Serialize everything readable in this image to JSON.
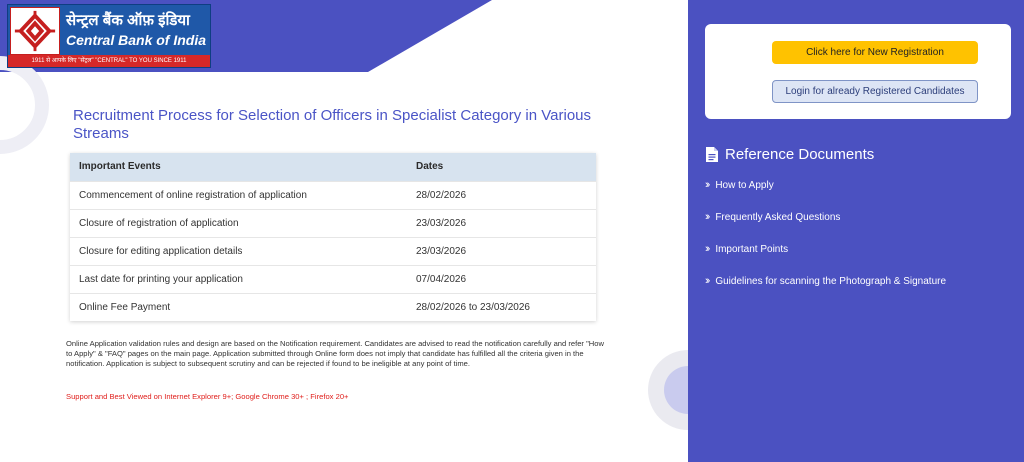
{
  "logo": {
    "hindi_name": "सेन्ट्रल बैंक ऑफ़ इंडिया",
    "english_name": "Central Bank of India",
    "tagline": "1911 से आपके लिए \"सेंट्रल\"   \"CENTRAL\" TO YOU SINCE 1911"
  },
  "colors": {
    "accent": "#4b51c1",
    "title": "#4a54c6",
    "cta": "#ffc200",
    "warning": "#e0201d"
  },
  "main": {
    "title": "Recruitment Process for Selection of Officers in Specialist Category in Various Streams",
    "table": {
      "headers": [
        "Important Events",
        "Dates"
      ],
      "rows": [
        [
          "Commencement of online registration of application",
          "28/02/2026"
        ],
        [
          "Closure of registration of application",
          "23/03/2026"
        ],
        [
          "Closure for editing application details",
          "23/03/2026"
        ],
        [
          "Last date for printing your application",
          "07/04/2026"
        ],
        [
          "Online Fee Payment",
          "28/02/2026 to 23/03/2026"
        ]
      ]
    },
    "note": "Online Application validation rules and design are based on the Notification requirement. Candidates are advised to read the notification carefully and refer \"How to Apply\" & \"FAQ\" pages on the main page. Application submitted through Online form does not imply that candidate has fulfilled all the criteria given in the notification. Application is subject to subsequent scrutiny and can be rejected if found to be ineligible at any point of time.",
    "support": "Support and Best Viewed on Internet Explorer 9+; Google Chrome 30+ ; Firefox 20+"
  },
  "sidebar": {
    "new_registration": "Click here for New Registration",
    "login": "Login for already Registered Candidates",
    "reference_title": "Reference Documents",
    "items": [
      "How to Apply",
      "Frequently Asked Questions",
      "Important Points",
      "Guidelines for scanning the Photograph & Signature"
    ]
  }
}
